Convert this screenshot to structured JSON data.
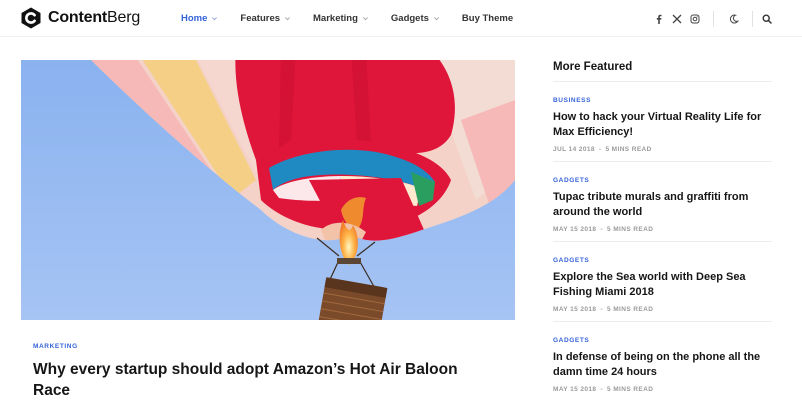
{
  "brand": {
    "name_bold": "Content",
    "name_light": "Berg"
  },
  "nav": {
    "items": [
      {
        "label": "Home",
        "active": true,
        "dropdown": true
      },
      {
        "label": "Features",
        "dropdown": true
      },
      {
        "label": "Marketing",
        "dropdown": true
      },
      {
        "label": "Gadgets",
        "dropdown": true
      },
      {
        "label": "Buy Theme",
        "dropdown": false
      }
    ]
  },
  "header_icons": [
    "facebook-icon",
    "x-twitter-icon",
    "instagram-icon",
    "dark-mode-moon-icon",
    "search-icon"
  ],
  "featured": {
    "category": "Marketing",
    "title": "Why every startup should adopt Amazon’s Hot Air Baloon Race"
  },
  "sidebar": {
    "heading": "More Featured",
    "posts": [
      {
        "category": "Business",
        "title": "How to hack your Virtual Reality Life for Max Efficiency!",
        "date": "Jul 14 2018",
        "read": "5 Mins Read"
      },
      {
        "category": "Gadgets",
        "title": "Tupac tribute murals and graffiti from around the world",
        "date": "May 15 2018",
        "read": "5 Mins Read"
      },
      {
        "category": "Gadgets",
        "title": "Explore the Sea world with Deep Sea Fishing Miami 2018",
        "date": "May 15 2018",
        "read": "5 Mins Read"
      },
      {
        "category": "Gadgets",
        "title": "In defense of being on the phone all the damn time 24 hours",
        "date": "May 15 2018",
        "read": "5 Mins Read"
      }
    ]
  },
  "colors": {
    "accent": "#3563d8",
    "text": "#161616",
    "meta": "#9a9a9a",
    "sky": "#8fb5f0"
  }
}
